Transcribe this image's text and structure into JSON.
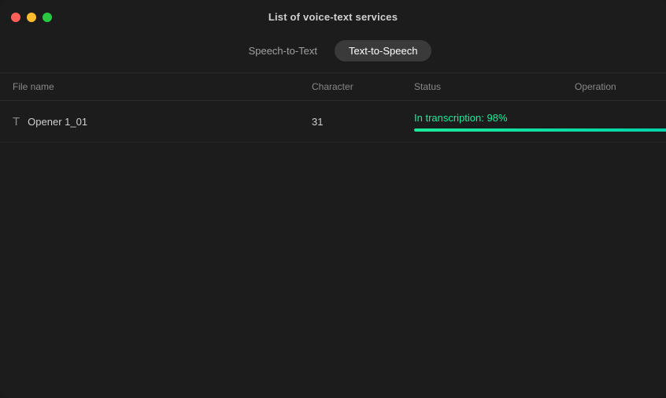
{
  "window": {
    "title": "List of voice-text services"
  },
  "controls": {
    "close_label": "",
    "minimize_label": "",
    "maximize_label": ""
  },
  "tabs": [
    {
      "label": "Speech-to-Text",
      "active": false
    },
    {
      "label": "Text-to-Speech",
      "active": true
    }
  ],
  "table": {
    "headers": {
      "file_name": "File name",
      "character": "Character",
      "status": "Status",
      "operation": "Operation"
    },
    "rows": [
      {
        "icon": "T",
        "file_name": "Opener 1_01",
        "character": "31",
        "status_text": "In transcription: 98%",
        "progress": 98,
        "delete_label": "🗑"
      }
    ]
  },
  "colors": {
    "accent": "#1de99b",
    "progress_bg": "#2e2e2e",
    "tab_active_bg": "#3a3a3a",
    "window_bg": "#1c1c1c"
  }
}
